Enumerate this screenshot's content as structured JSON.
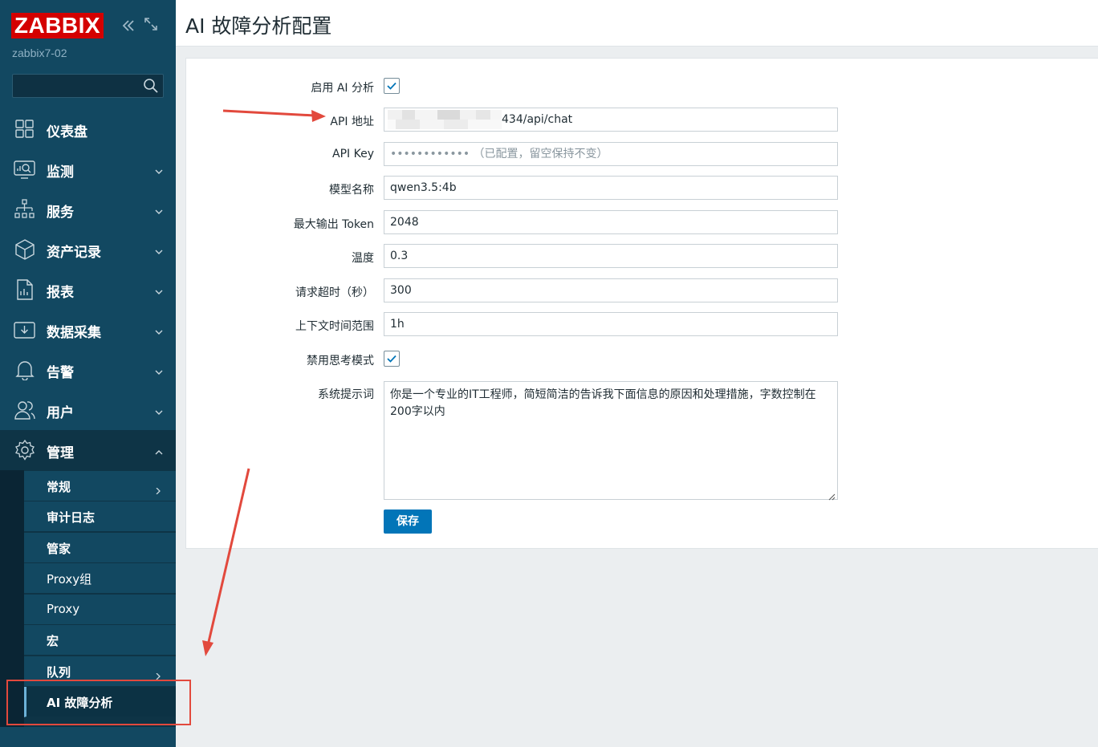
{
  "app": {
    "logo_text": "ZABBIX",
    "server_name": "zabbix7-02",
    "brand_color": "#d40000",
    "sidebar_color": "#124861",
    "accent_color": "#0275b8"
  },
  "search": {
    "placeholder": ""
  },
  "nav": {
    "items": [
      {
        "label": "仪表盘",
        "icon": "dashboard-icon"
      },
      {
        "label": "监测",
        "icon": "monitoring-icon"
      },
      {
        "label": "服务",
        "icon": "services-icon"
      },
      {
        "label": "资产记录",
        "icon": "inventory-icon"
      },
      {
        "label": "报表",
        "icon": "reports-icon"
      },
      {
        "label": "数据采集",
        "icon": "data-collection-icon"
      },
      {
        "label": "告警",
        "icon": "alerts-icon"
      },
      {
        "label": "用户",
        "icon": "users-icon"
      },
      {
        "label": "管理",
        "icon": "gear-icon"
      }
    ],
    "admin_submenu": [
      {
        "label": "常规"
      },
      {
        "label": "审计日志"
      },
      {
        "label": "管家"
      },
      {
        "label": "Proxy组"
      },
      {
        "label": "Proxy"
      },
      {
        "label": "宏"
      },
      {
        "label": "队列"
      },
      {
        "label": "AI 故障分析"
      }
    ]
  },
  "header": {
    "title": "AI 故障分析配置"
  },
  "form": {
    "enable_ai": {
      "label": "启用 AI 分析",
      "checked": true
    },
    "api_url": {
      "label": "API 地址",
      "value_visible": "434/api/chat"
    },
    "api_key": {
      "label": "API Key",
      "placeholder": "•••••••••••• （已配置，留空保持不变）"
    },
    "model_name": {
      "label": "模型名称",
      "value": "qwen3.5:4b"
    },
    "max_tokens": {
      "label": "最大输出 Token",
      "value": "2048"
    },
    "temperature": {
      "label": "温度",
      "value": "0.3"
    },
    "timeout": {
      "label": "请求超时（秒）",
      "value": "300"
    },
    "context_range": {
      "label": "上下文时间范围",
      "value": "1h"
    },
    "disable_thinking": {
      "label": "禁用思考模式",
      "checked": true
    },
    "system_prompt": {
      "label": "系统提示词",
      "value": "你是一个专业的IT工程师，简短简洁的告诉我下面信息的原因和处理措施，字数控制在200字以内"
    },
    "save_label": "保存"
  }
}
